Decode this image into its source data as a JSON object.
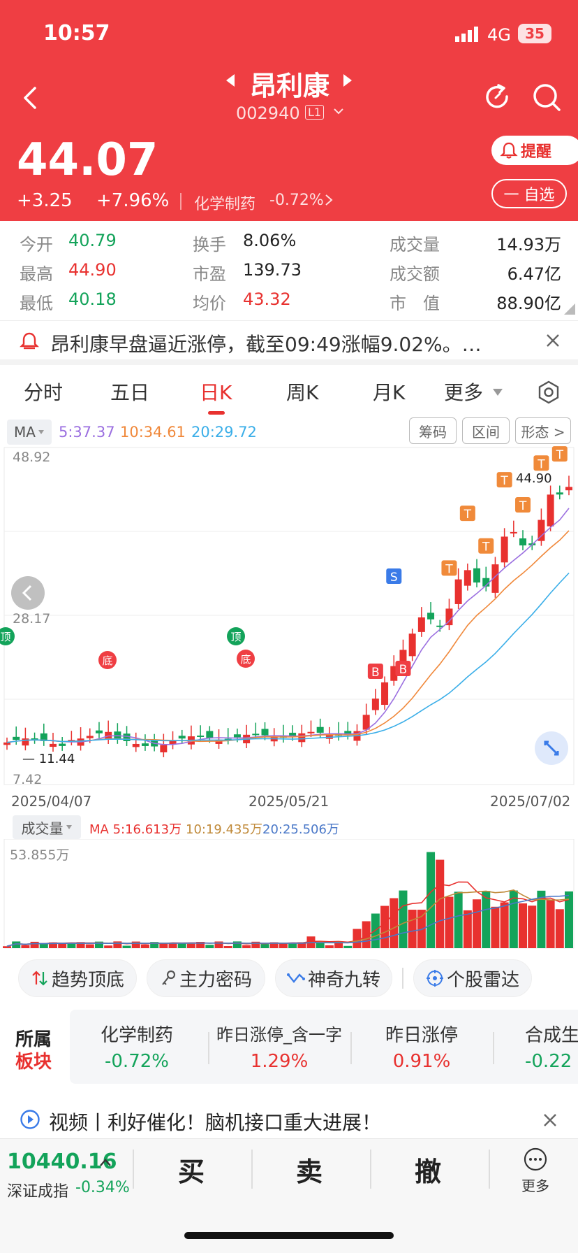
{
  "status_bar": {
    "time": "10:57",
    "network": "4G",
    "battery": "35"
  },
  "header": {
    "title": "昂利康",
    "code": "002940",
    "level": "L1",
    "price": "44.07",
    "change": "+3.25",
    "change_pct": "+7.96%",
    "sector": "化学制药",
    "sector_pct": "-0.72%",
    "alert_label": "提醒",
    "watch_label": "一 自选"
  },
  "quote": {
    "open_label": "今开",
    "open": "40.79",
    "high_label": "最高",
    "high": "44.90",
    "low_label": "最低",
    "low": "40.18",
    "turnover_label": "换手",
    "turnover": "8.06%",
    "pe_label": "市盈",
    "pe": "139.73",
    "avg_label": "均价",
    "avg": "43.32",
    "volume_label": "成交量",
    "volume": "14.93万",
    "amount_label": "成交额",
    "amount": "6.47亿",
    "mktcap_label": "市　值",
    "mktcap": "88.90亿"
  },
  "news": {
    "text": "昂利康早盘逼近涨停，截至09:49涨幅9.02%。…"
  },
  "tabs": [
    "分时",
    "五日",
    "日K",
    "周K",
    "月K",
    "更多"
  ],
  "ma": {
    "label": "MA",
    "ma5": "5:37.37",
    "ma10": "10:34.61",
    "ma20": "20:29.72",
    "chips": [
      "筹码",
      "区间",
      "形态 >"
    ]
  },
  "kline": {
    "y_top": "48.92",
    "y_mid": "28.17",
    "y_bottom": "7.42",
    "max_label": "44.90",
    "min_label": "11.44",
    "dates": [
      "2025/04/07",
      "2025/05/21",
      "2025/07/02"
    ],
    "top_label": "顶",
    "bottom_label": "底",
    "buy_label": "B",
    "sell_label": "S",
    "t_label": "T"
  },
  "volume": {
    "label": "成交量",
    "ma5": "MA 5:16.613万",
    "ma10": "10:19.435万",
    "ma20": "20:25.506万",
    "y_top": "53.855万"
  },
  "tools": [
    "趋势顶底",
    "主力密码",
    "神奇九转",
    "个股雷达"
  ],
  "sectors": {
    "label_top": "所属",
    "label_bottom": "板块",
    "items": [
      {
        "name": "化学制药",
        "pct": "-0.72%"
      },
      {
        "name": "昨日涨停_含一字",
        "pct": "1.29%"
      },
      {
        "name": "昨日涨停",
        "pct": "0.91%"
      },
      {
        "name": "合成生",
        "pct": "-0.22"
      }
    ]
  },
  "video": {
    "text": "视频丨利好催化！脑机接口重大进展！"
  },
  "bottom": {
    "index_value": "10440.16",
    "index_name": "深证成指",
    "index_pct": "-0.34%",
    "buy": "买",
    "sell": "卖",
    "cancel": "撤",
    "more": "更多"
  },
  "colors": {
    "up": "#e8312f",
    "down": "#13a35a",
    "header": "#ef3e43",
    "ma5": "#9b6fe0",
    "ma10": "#f0883a",
    "ma20": "#3aaee8"
  }
}
